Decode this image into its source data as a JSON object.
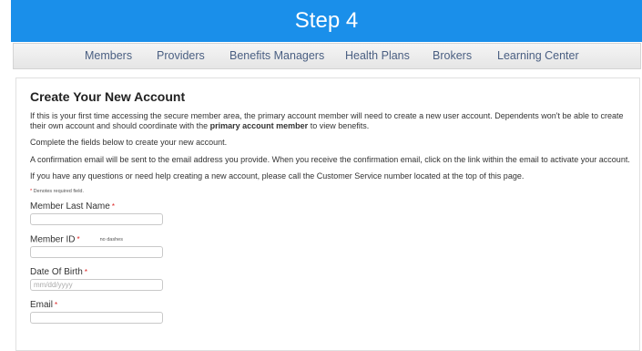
{
  "banner": {
    "title": "Step 4"
  },
  "nav": {
    "items": [
      {
        "label": "Members"
      },
      {
        "label": "Providers"
      },
      {
        "label": "Benefits Managers"
      },
      {
        "label": "Health Plans"
      },
      {
        "label": "Brokers"
      },
      {
        "label": "Learning Center"
      }
    ]
  },
  "form": {
    "heading": "Create Your New Account",
    "intro_part1": "If this is your first time accessing the secure member area, the primary account member will need to create a new user account. Dependents won't be able to create their own account and should coordinate with the ",
    "intro_bold": "primary account member",
    "intro_part2": " to view benefits.",
    "para2": "Complete the fields below to create your new account.",
    "para3": "A confirmation email will be sent to the email address you provide. When you receive the confirmation email, click on the link within the email to activate your account.",
    "para4": "If you have any questions or need help creating a new account, please call the Customer Service number located at the top of this page.",
    "required_star": "*",
    "required_note": "Denotes required field.",
    "fields": {
      "last_name": {
        "label": "Member Last Name",
        "value": "",
        "placeholder": ""
      },
      "member_id": {
        "label": "Member ID",
        "hint": "no dashes",
        "value": "",
        "placeholder": ""
      },
      "dob": {
        "label": "Date Of Birth",
        "value": "",
        "placeholder": "mm/dd/yyyy"
      },
      "email": {
        "label": "Email",
        "value": "",
        "placeholder": ""
      }
    }
  },
  "colors": {
    "banner_bg": "#1a8fea",
    "nav_text": "#4a5f82",
    "required_star": "#d22222"
  }
}
